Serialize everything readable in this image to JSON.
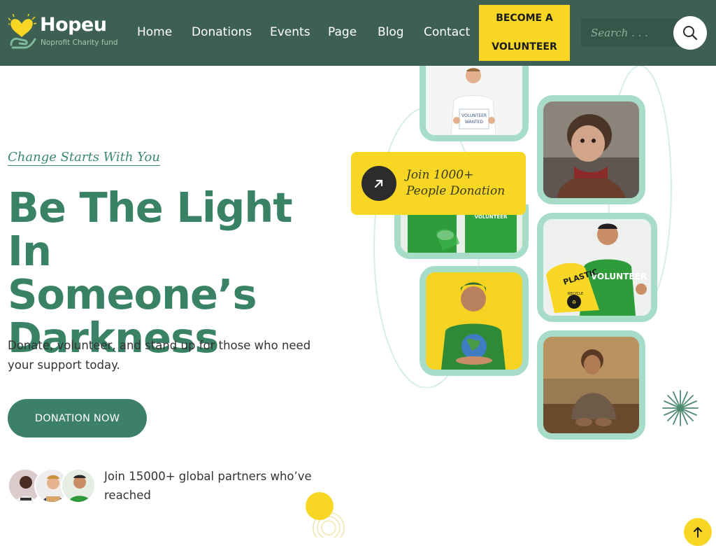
{
  "brand": {
    "name": "Hopeu",
    "tagline": "Noprofit Charity fund",
    "accent": "#3a8266",
    "header_bg": "#3e6052",
    "yellow": "#f7d724"
  },
  "nav": {
    "items": [
      {
        "label": "Home"
      },
      {
        "label": "Donations"
      },
      {
        "label": "Events"
      },
      {
        "label": "Page"
      },
      {
        "label": "Blog"
      },
      {
        "label": "Contact"
      }
    ],
    "cta_line1": "BECOME A",
    "cta_line2": "VOLUNTEER"
  },
  "search": {
    "placeholder": "Search . . .",
    "icon": "search-icon"
  },
  "hero": {
    "eyebrow": "Change Starts With You",
    "headline_lines": [
      "Be The Light In",
      "Someone’s",
      "Darkness"
    ],
    "subtext": "Donate, volunteer, and stand up for those who need your support today.",
    "donate_label": "DONATION NOW",
    "partners_text": "Join 15000+ global partners who’ve reached"
  },
  "collage": {
    "join_line1": "Join 1000+",
    "join_line2": "People Donation",
    "join_icon": "arrow-up-right-icon",
    "sign_line1": "VOLUNTEER",
    "sign_line2": "WANTED",
    "shirt_text": "VOLUNTEER",
    "bag_text": "PLASTIC",
    "bag_sub": "RECYCLE"
  },
  "scroll_top_icon": "arrow-up-icon"
}
